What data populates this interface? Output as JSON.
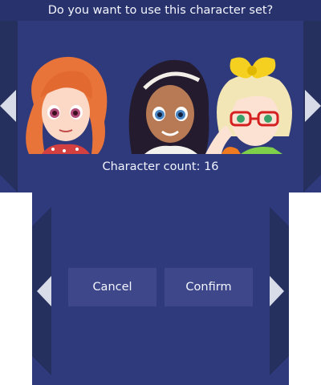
{
  "dialog": {
    "question": "Do you want to use this character set?",
    "count_text": "Character count: 16"
  },
  "characters": [
    {
      "name": "portrait-orange-hair",
      "hair_color": "#e8743a"
    },
    {
      "name": "portrait-dark-hair-headband",
      "hair_color": "#241c2e"
    },
    {
      "name": "portrait-blonde-bow-glasses",
      "hair_color": "#f2e6b6"
    }
  ],
  "buttons": {
    "cancel_label": "Cancel",
    "confirm_label": "Confirm"
  },
  "colors": {
    "panel": "#2f3a7c",
    "title_bar": "#28326c",
    "button": "#3d478a",
    "arrow": "#d8dbe8"
  },
  "icons": {
    "left_arrow": "triangle-left-icon",
    "right_arrow": "triangle-right-icon"
  }
}
